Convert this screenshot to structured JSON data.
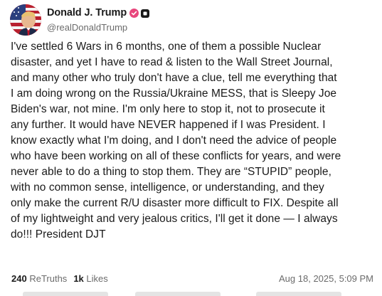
{
  "post": {
    "author": {
      "display_name": "Donald J. Trump",
      "handle": "@realDonaldTrump",
      "verified_icon": "verified-badge-icon",
      "extra_icon": "square-badge-icon"
    },
    "body_lines": [
      "I've settled 6 Wars in 6 months, one of them a possible Nuclear",
      "disaster, and yet I have to read & listen to the Wall Street Journal,",
      "and many other who truly don't have a clue, tell me everything that",
      "I am doing wrong on the Russia/Ukraine MESS, that is Sleepy Joe",
      "Biden's war, not mine. I'm only here to stop it, not to prosecute it",
      "any further. It would have NEVER happened if I was President. I",
      "know exactly what I'm doing, and I don't need the advice of people",
      "who have been working on all of these conflicts for years, and were",
      "never able to do a thing to stop them. They are “STUPID” people,",
      "with no common sense, intelligence, or understanding, and they",
      "only make the current R/U disaster more difficult to FIX. Despite all",
      "of my lightweight and very jealous critics, I'll get it done — I always",
      "do!!! President DJT"
    ],
    "stats": {
      "retruths_count": "240",
      "retruths_label": "ReTruths",
      "likes_count": "1k",
      "likes_label": "Likes"
    },
    "timestamp": "Aug 18, 2025, 5:09 PM"
  },
  "colors": {
    "verified_badge": "#e8467c",
    "secondary_text": "#6b6b6b",
    "primary_text": "#1a1a1a"
  }
}
